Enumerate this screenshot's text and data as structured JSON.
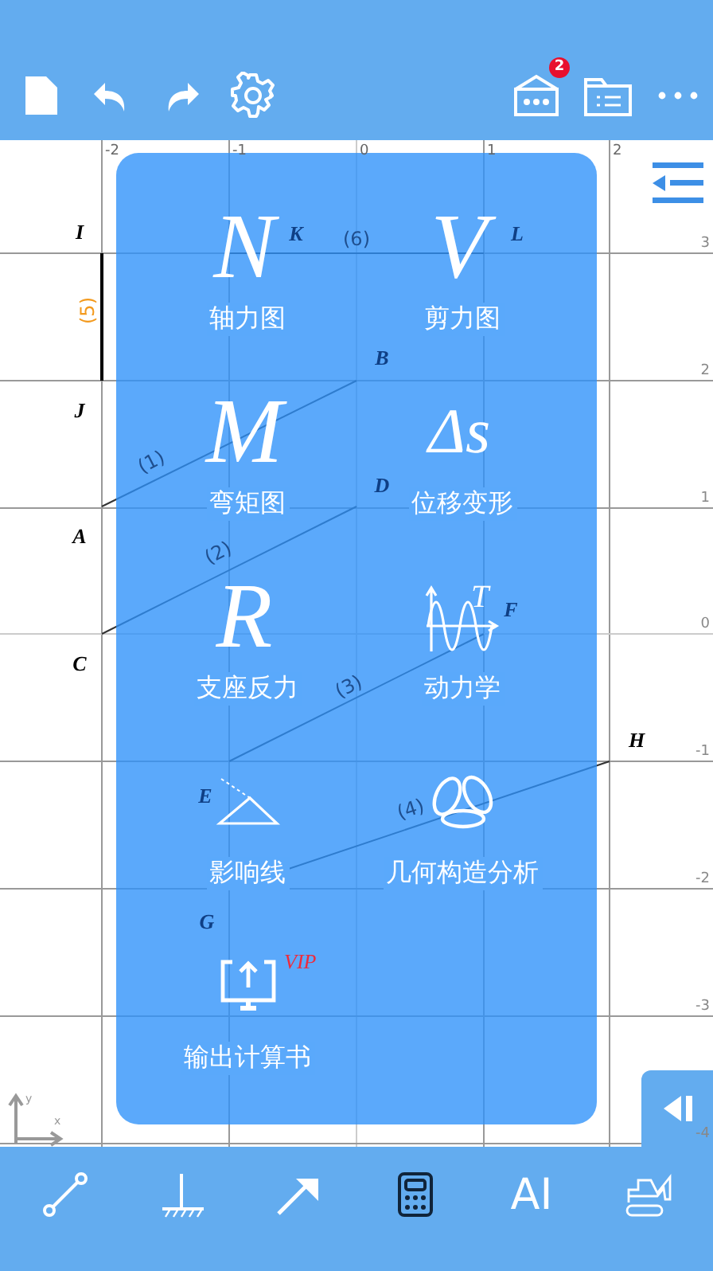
{
  "header": {
    "badge": "2"
  },
  "canvas": {
    "x_ticks": [
      "-2",
      "-1",
      "0",
      "1",
      "2"
    ],
    "y_ticks": [
      "3",
      "2",
      "1",
      "0",
      "-1",
      "-2",
      "-3",
      "-4"
    ],
    "node_labels": [
      "I",
      "J",
      "A",
      "C",
      "K",
      "L",
      "B",
      "D",
      "F",
      "E",
      "G",
      "H"
    ],
    "members": [
      {
        "label": "(1)",
        "selected": false
      },
      {
        "label": "(2)",
        "selected": false
      },
      {
        "label": "(3)",
        "selected": false
      },
      {
        "label": "(4)",
        "selected": false
      },
      {
        "label": "(5)",
        "selected": true
      },
      {
        "label": "(6)",
        "selected": false
      }
    ],
    "axis_labels": [
      "y",
      "x"
    ]
  },
  "menu": [
    {
      "kind": "symbol",
      "symbol": "N",
      "label": "轴力图"
    },
    {
      "kind": "symbol",
      "symbol": "V",
      "label": "剪力图"
    },
    {
      "kind": "symbol",
      "symbol": "M",
      "label": "弯矩图"
    },
    {
      "kind": "symbol",
      "symbol": "Δs",
      "label": "位移变形"
    },
    {
      "kind": "symbol",
      "symbol": "R",
      "label": "支座反力"
    },
    {
      "kind": "dynamics",
      "symbol": "T",
      "label": "动力学"
    },
    {
      "kind": "influence",
      "label": "影响线"
    },
    {
      "kind": "geometry",
      "label": "几何构造分析"
    },
    {
      "kind": "export",
      "tag": "VIP",
      "label": "输出计算书"
    }
  ],
  "toolbar": [
    {
      "kind": "member",
      "selected": false
    },
    {
      "kind": "support",
      "selected": false
    },
    {
      "kind": "load",
      "selected": false
    },
    {
      "kind": "calculator",
      "selected": true
    },
    {
      "kind": "text",
      "label": "AI",
      "selected": false
    },
    {
      "kind": "excavator",
      "selected": false
    }
  ]
}
